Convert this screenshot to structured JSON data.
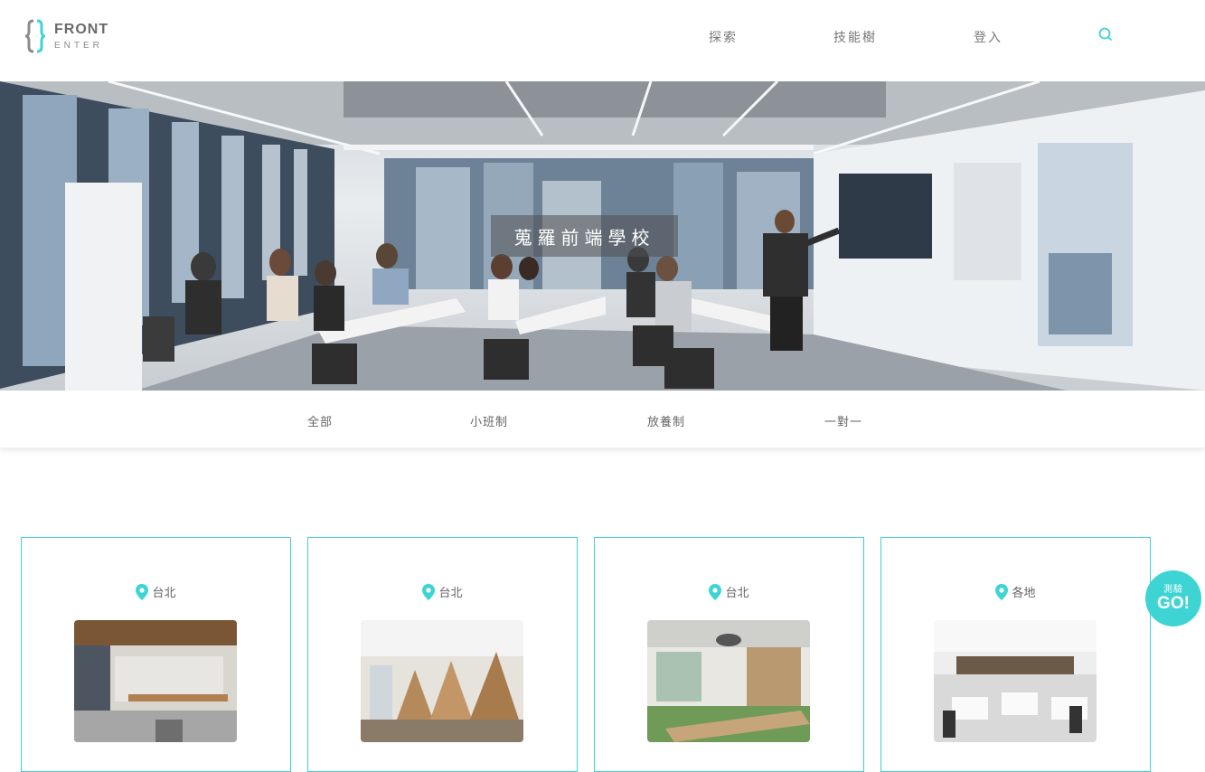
{
  "header": {
    "logo_line1": "FRONT",
    "logo_line2": "ENTER",
    "nav": [
      {
        "label": "探索"
      },
      {
        "label": "技能樹"
      },
      {
        "label": "登入"
      }
    ],
    "search_icon": "search-icon"
  },
  "hero": {
    "title": "蒐羅前端學校"
  },
  "filters": [
    {
      "label": "全部"
    },
    {
      "label": "小班制"
    },
    {
      "label": "放養制"
    },
    {
      "label": "一對一"
    }
  ],
  "cards": [
    {
      "location": "台北"
    },
    {
      "location": "台北"
    },
    {
      "location": "台北"
    },
    {
      "location": "各地"
    }
  ],
  "quiz_button": {
    "small": "測驗",
    "big": "GO!"
  },
  "colors": {
    "accent": "#3fd4d4",
    "card_border": "#3fd0d0"
  }
}
